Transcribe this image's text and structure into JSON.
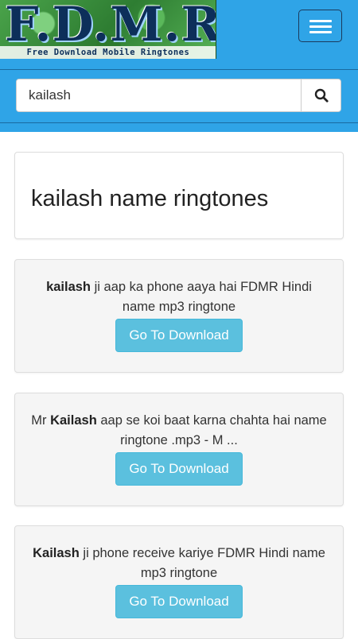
{
  "header": {
    "logo_title": "F.D.M.R",
    "logo_subtitle": "Free Download Mobile Ringtones",
    "menu_icon": "hamburger-menu-icon",
    "color": "#2fa4e7"
  },
  "search": {
    "value": "kailash",
    "icon": "search-icon"
  },
  "page_title": "kailash name ringtones",
  "items": [
    {
      "bold": "kailash",
      "rest": " ji aap ka phone aaya hai FDMR Hindi name mp3 ringtone",
      "button": "Go To Download"
    },
    {
      "prefix": "Mr ",
      "bold": "Kailash",
      "rest": " aap se koi baat karna chahta hai name ringtone .mp3 - M ...",
      "button": "Go To Download"
    },
    {
      "bold": "Kailash",
      "rest": " ji phone receive kariye FDMR Hindi name mp3 ringtone",
      "button": "Go To Download"
    }
  ],
  "colors": {
    "button": "#5bc0de",
    "panel": "#f5f5f5"
  }
}
